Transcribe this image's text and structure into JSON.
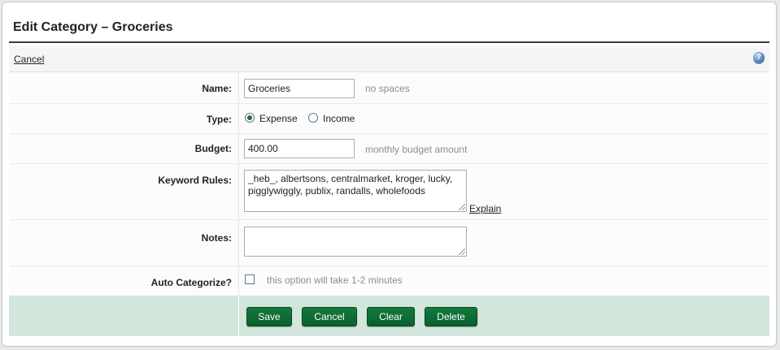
{
  "header": {
    "title": "Edit Category – Groceries"
  },
  "toolbar": {
    "cancel_label": "Cancel",
    "help_icon": "?"
  },
  "form": {
    "name": {
      "label": "Name:",
      "value": "Groceries",
      "hint": "no spaces"
    },
    "type": {
      "label": "Type:",
      "options": [
        {
          "label": "Expense",
          "checked": true
        },
        {
          "label": "Income",
          "checked": false
        }
      ]
    },
    "budget": {
      "label": "Budget:",
      "value": "400.00",
      "hint": "monthly budget amount"
    },
    "keyword_rules": {
      "label": "Keyword Rules:",
      "value": "_heb_, albertsons, centralmarket, kroger, lucky, pigglywiggly, publix, randalls, wholefoods",
      "explain_label": "Explain"
    },
    "notes": {
      "label": "Notes:",
      "value": ""
    },
    "auto_categorize": {
      "label": "Auto Categorize?",
      "checked": false,
      "hint": "this option will take 1-2 minutes"
    }
  },
  "actions": {
    "save": "Save",
    "cancel": "Cancel",
    "clear": "Clear",
    "delete": "Delete"
  }
}
